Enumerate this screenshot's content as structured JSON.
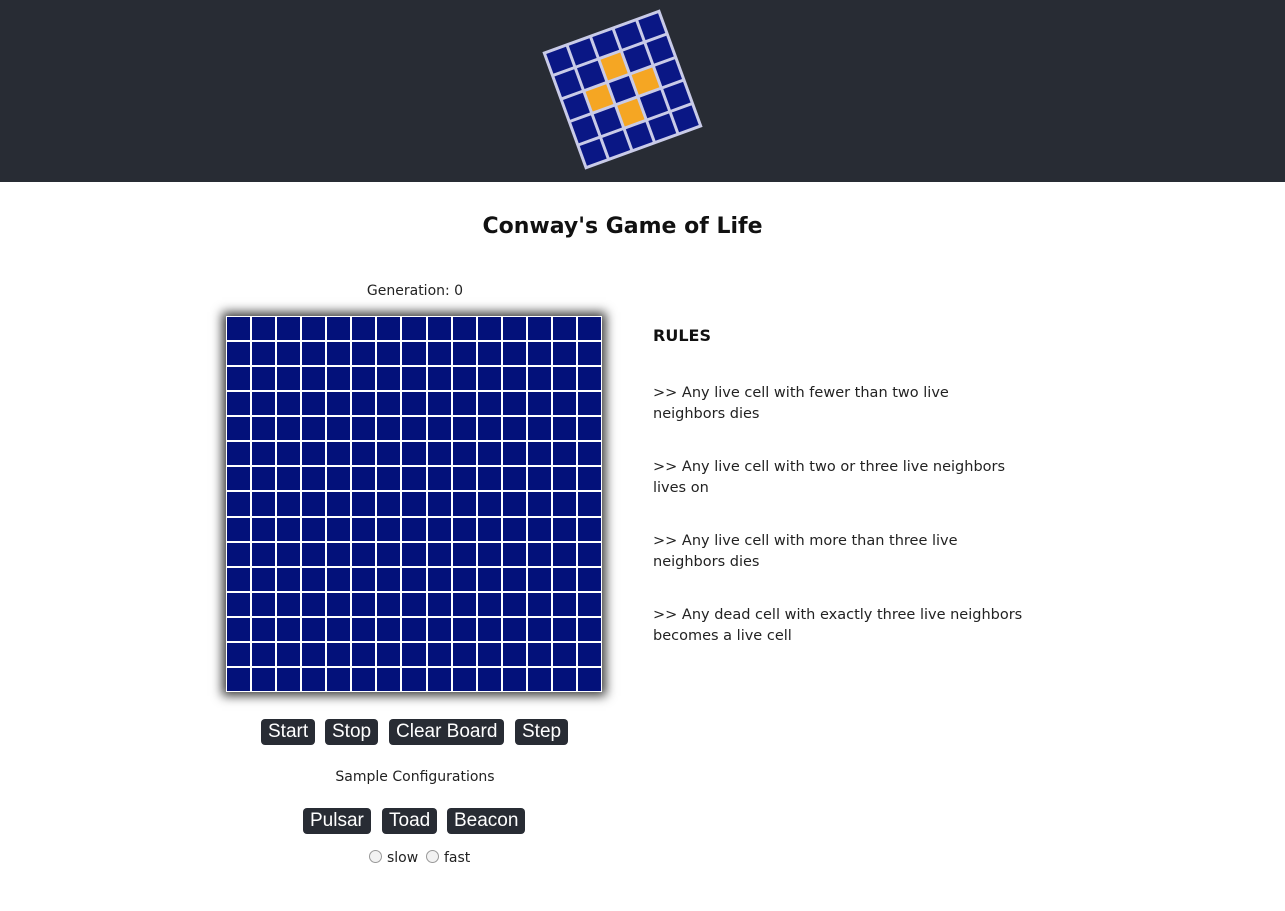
{
  "header": {
    "logo_grid": [
      [
        0,
        0,
        0,
        0,
        0
      ],
      [
        0,
        0,
        1,
        0,
        0
      ],
      [
        0,
        1,
        0,
        1,
        0
      ],
      [
        0,
        0,
        1,
        0,
        0
      ],
      [
        0,
        0,
        0,
        0,
        0
      ]
    ]
  },
  "page": {
    "title": "Conway's Game of Life"
  },
  "board": {
    "generation_label": "Generation: 0",
    "rows": 15,
    "cols": 15
  },
  "controls": {
    "start": "Start",
    "stop": "Stop",
    "clear": "Clear Board",
    "step": "Step"
  },
  "samples": {
    "label": "Sample Configurations",
    "pulsar": "Pulsar",
    "toad": "Toad",
    "beacon": "Beacon"
  },
  "speed": {
    "slow": "slow",
    "fast": "fast"
  },
  "rules": {
    "title": "RULES",
    "items": [
      ">> Any live cell with fewer than two live neighbors dies",
      ">> Any live cell with two or three live neighbors lives on",
      ">> Any live cell with more than three live neighbors dies",
      ">> Any dead cell with exactly three live neighbors becomes a live cell"
    ]
  },
  "colors": {
    "header_bg": "#282c34",
    "cell_dead": "#03117a",
    "cell_alive": "#f5a623",
    "button_bg": "#282c34"
  }
}
